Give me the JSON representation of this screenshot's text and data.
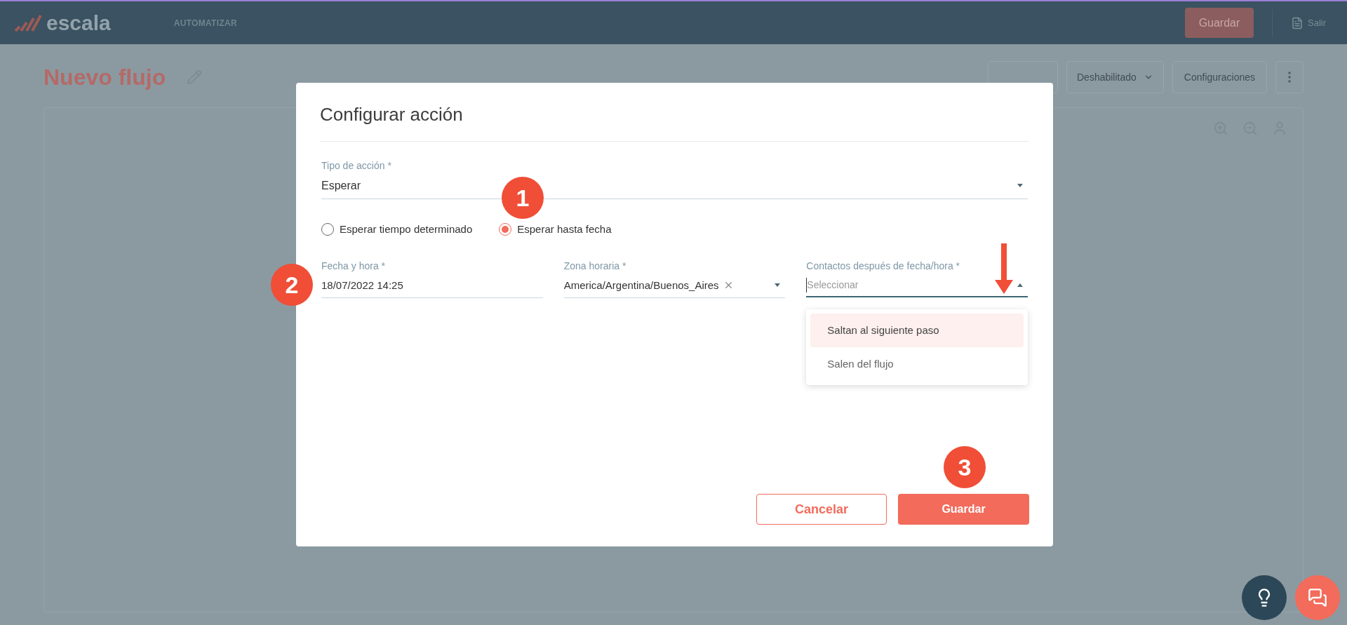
{
  "header": {
    "logo": "escala",
    "nav_item": "AUTOMATIZAR",
    "save_button": "Guardar",
    "logout_link": "Salir"
  },
  "page": {
    "title": "Nuevo flujo",
    "status_dropdown": "Deshabilitado",
    "settings_button": "Configuraciones"
  },
  "modal": {
    "title": "Configurar acción",
    "action_type": {
      "label": "Tipo de acción *",
      "value": "Esperar"
    },
    "wait_modes": [
      {
        "label": "Esperar tiempo determinado",
        "selected": false
      },
      {
        "label": "Esperar hasta fecha",
        "selected": true
      }
    ],
    "fields": [
      {
        "kind": "text",
        "label": "Fecha y hora *",
        "value": "18/07/2022 14:25"
      },
      {
        "kind": "select",
        "label": "Zona horaria *",
        "value": "America/Argentina/Buenos_Aires",
        "clearable": true,
        "expanded": false
      },
      {
        "kind": "select",
        "label": "Contactos después de fecha/hora *",
        "placeholder": "Seleccionar",
        "clearable": false,
        "expanded": true
      }
    ],
    "dropdown_options": [
      {
        "label": "Saltan al siguiente paso",
        "highlighted": true
      },
      {
        "label": "Salen del flujo",
        "highlighted": false
      }
    ],
    "cancel_button": "Cancelar",
    "save_button": "Guardar"
  },
  "annotations": [
    {
      "kind": "badge",
      "text": "1"
    },
    {
      "kind": "badge",
      "text": "2"
    },
    {
      "kind": "badge",
      "text": "3"
    },
    {
      "kind": "arrow"
    }
  ]
}
